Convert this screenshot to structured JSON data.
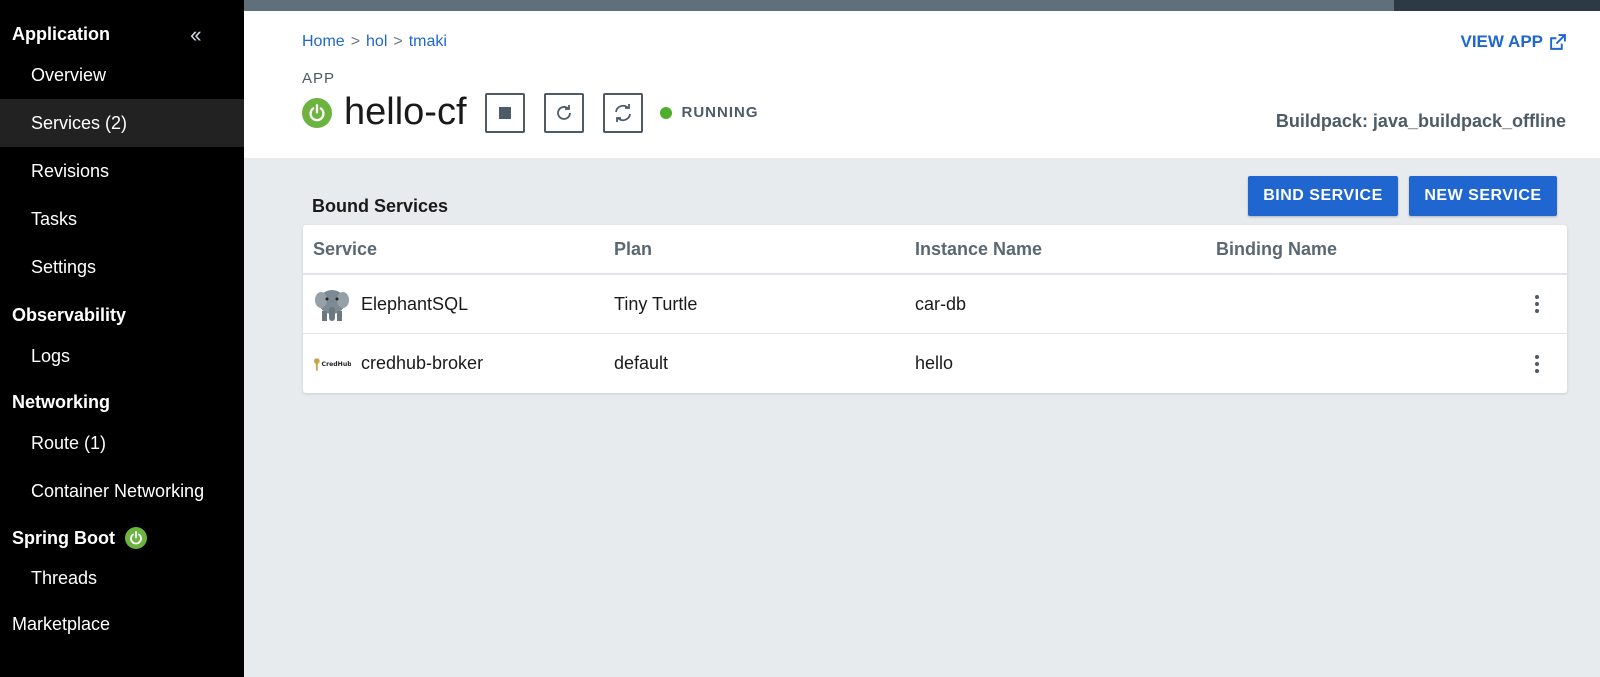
{
  "colors": {
    "accent": "#1f66d1",
    "spring": "#6db33f",
    "running": "#4fae2b",
    "sidebar_bg": "#000000"
  },
  "sidebar": {
    "collapse_icon": "double-chevron-left-icon",
    "sections": [
      {
        "title": "Application",
        "items": [
          {
            "label": "Overview"
          },
          {
            "label": "Services (2)",
            "active": true
          },
          {
            "label": "Revisions"
          },
          {
            "label": "Tasks"
          },
          {
            "label": "Settings"
          }
        ]
      },
      {
        "title": "Observability",
        "items": [
          {
            "label": "Logs"
          }
        ]
      },
      {
        "title": "Networking",
        "items": [
          {
            "label": "Route (1)"
          },
          {
            "label": "Container Networking"
          }
        ]
      },
      {
        "title": "Spring Boot",
        "icon": "spring-power-icon",
        "items": [
          {
            "label": "Threads"
          }
        ]
      },
      {
        "title": "Marketplace",
        "items": []
      }
    ]
  },
  "header": {
    "breadcrumb": [
      "Home",
      "hol",
      "tmaki"
    ],
    "breadcrumb_sep": ">",
    "view_app": "VIEW APP",
    "kicker": "APP",
    "app_name": "hello-cf",
    "status": "RUNNING",
    "buildpack": "Buildpack: java_buildpack_offline"
  },
  "main": {
    "section_title": "Bound Services",
    "bind_button": "BIND SERVICE",
    "new_button": "NEW SERVICE",
    "columns": [
      "Service",
      "Plan",
      "Instance Name",
      "Binding Name"
    ],
    "rows": [
      {
        "service": "ElephantSQL",
        "plan": "Tiny Turtle",
        "instance": "car-db",
        "binding": "",
        "icon": "elephant-icon"
      },
      {
        "service": "credhub-broker",
        "plan": "default",
        "instance": "hello",
        "binding": "",
        "icon": "credhub-logo-icon"
      }
    ]
  }
}
